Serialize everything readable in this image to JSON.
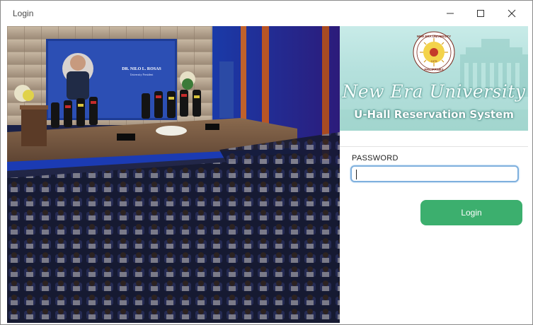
{
  "window": {
    "title": "Login",
    "controls": {
      "minimize": "minimize-icon",
      "maximize": "maximize-icon",
      "close": "close-icon"
    }
  },
  "banner": {
    "seal_text_top": "NEW ERA UNIVERSITY",
    "seal_text_bottom": "PHILIPPINES",
    "seal_year": "1975",
    "university_name": "New Era University",
    "system_name": "U-Hall Reservation System"
  },
  "photo": {
    "screen_caption_name": "DR. NILO L. ROSAS",
    "screen_caption_title": "University President"
  },
  "form": {
    "password_label": "PASSWORD",
    "password_value": "",
    "login_label": "Login"
  },
  "colors": {
    "login_button": "#3caf6e",
    "input_focus_border": "#7fb0de",
    "banner_teal": "#b4e0dc"
  }
}
